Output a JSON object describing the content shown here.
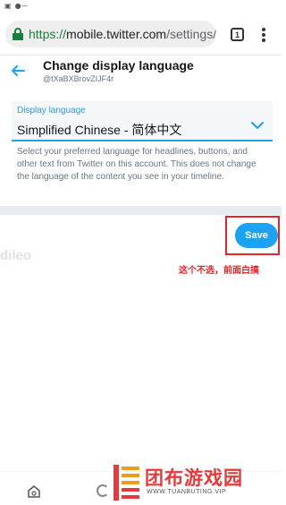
{
  "status_bar": {
    "icons": [
      "image-icon",
      "key-icon"
    ]
  },
  "browser": {
    "url_scheme": "https://",
    "url_host": "mobile.twitter.com",
    "url_path": "/settings/l",
    "tab_count": "1"
  },
  "header": {
    "title": "Change display language",
    "handle": "@tXaBXBrovZIJF4r"
  },
  "language_field": {
    "label": "Display language",
    "value": "Simplified Chinese - 简体中文"
  },
  "help_text": "Select your preferred language for headlines, buttons, and other text from Twitter on this account. This does not change the language of the content you see in your timeline.",
  "save_button": "Save",
  "annotation": "这个不选，前面白搞",
  "watermark_left": "dileo",
  "brand": {
    "name": "团布游戏园",
    "url": "WWW.TUANBUTING.VIP"
  },
  "colors": {
    "accent": "#1da1f2",
    "annotation_red": "#e0262b",
    "secure_green": "#188038"
  }
}
